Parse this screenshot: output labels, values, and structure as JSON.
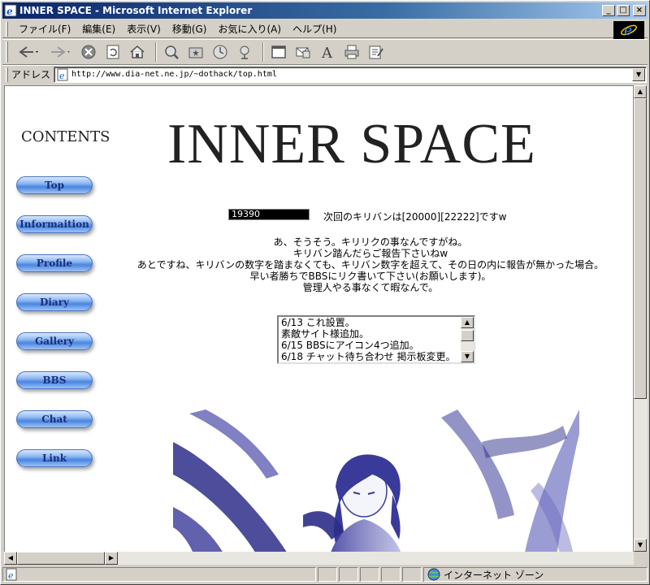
{
  "window": {
    "title": "INNER SPACE - Microsoft Internet Explorer"
  },
  "menu": {
    "items": [
      "ファイル(F)",
      "編集(E)",
      "表示(V)",
      "移動(G)",
      "お気に入り(A)",
      "ヘルプ(H)"
    ]
  },
  "toolbar": {
    "buttons": [
      "back-icon",
      "forward-icon",
      "stop-icon",
      "refresh-icon",
      "home-icon",
      "search-icon",
      "favorites-icon",
      "history-icon",
      "channels-icon",
      "fullscreen-icon",
      "mail-icon",
      "font-icon",
      "print-icon",
      "edit-icon"
    ]
  },
  "address": {
    "label": "アドレス",
    "url": "http://www.dia-net.ne.jp/~dothack/top.html"
  },
  "page": {
    "contents_title": "CONTENTS",
    "nav": [
      "Top",
      "Informaition",
      "Profile",
      "Diary",
      "Gallery",
      "BBS",
      "Chat",
      "Link"
    ],
    "main_title": "INNER SPACE",
    "counter": "19390",
    "counter_message": "次回のキリバンは[20000][22222]ですw",
    "messages": [
      "あ、そうそう。キリリクの事なんですがね。",
      "キリバン踏んだらご報告下さいねw",
      "あとですね、キリバンの数字を踏まなくても、キリバン数字を超えて、その日の内に報告が無かった場合。",
      "早い者勝ちでBBSにリク書いて下さい(お願いします)。",
      "管理人やる事なくて暇なんで。"
    ],
    "updates": [
      "6/13  これ設置。",
      "        素敵サイト様追加。",
      "6/15  BBSにアイコン4つ追加。",
      "6/18  チャット待ち合わせ 掲示板変更。"
    ]
  },
  "status": {
    "zone": "インターネット ゾーン"
  },
  "colors": {
    "title_bar": "#0a246a",
    "nav_button": "#6f9ff0",
    "art_ink": "#2a2a80"
  }
}
